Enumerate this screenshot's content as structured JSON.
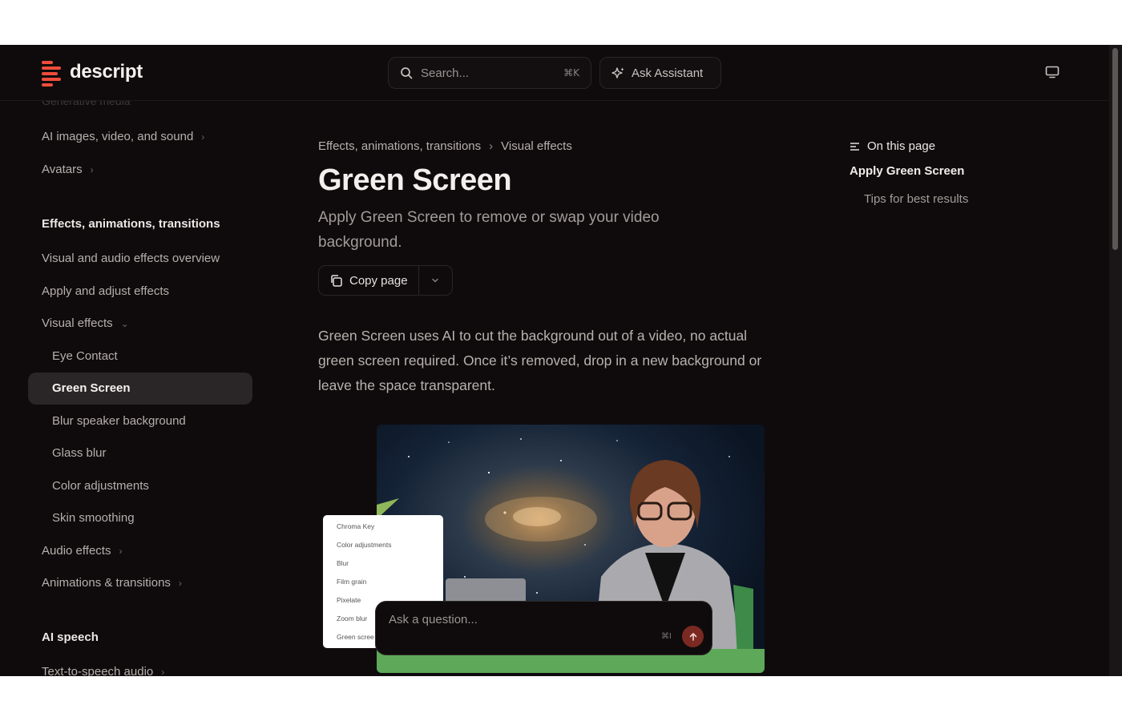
{
  "brand": {
    "name": "descript",
    "accent": "#ef4d3b"
  },
  "header": {
    "search_placeholder": "Search...",
    "search_shortcut": "⌘K",
    "assistant_label": "Ask Assistant"
  },
  "sidebar": {
    "faded_top": "Generative media",
    "items": [
      {
        "label": "AI images, video, and sound",
        "chevron": "›"
      },
      {
        "label": "Avatars",
        "chevron": "›"
      },
      {
        "label": "Effects, animations, transitions"
      },
      {
        "label": "Visual and audio effects overview"
      },
      {
        "label": "Apply and adjust effects"
      },
      {
        "label": "Visual effects",
        "chevron": "⌄"
      },
      {
        "label": "Eye Contact"
      },
      {
        "label": "Green Screen"
      },
      {
        "label": "Blur speaker background"
      },
      {
        "label": "Glass blur"
      },
      {
        "label": "Color adjustments"
      },
      {
        "label": "Skin smoothing"
      },
      {
        "label": "Audio effects",
        "chevron": "›"
      },
      {
        "label": "Animations & transitions",
        "chevron": "›"
      },
      {
        "label": "AI speech"
      },
      {
        "label": "Text-to-speech audio",
        "chevron": "›"
      }
    ]
  },
  "main": {
    "breadcrumb": [
      "Effects, animations, transitions",
      "Visual effects"
    ],
    "breadcrumb_sep": "›",
    "title": "Green Screen",
    "subtitle": "Apply Green Screen to remove or swap your video background.",
    "copy_label": "Copy page",
    "body": "Green Screen uses AI to cut the background out of a video, no actual green screen required. Once it’s removed, drop in a new background or leave the space transparent.",
    "effects_menu": [
      "Chroma Key",
      "Color adjustments",
      "Blur",
      "Film grain",
      "Pixelate",
      "Zoom blur",
      "Green scree"
    ],
    "ask_placeholder": "Ask a question...",
    "ask_shortcut": "⌘I"
  },
  "toc": {
    "heading": "On this page",
    "items": [
      "Apply Green Screen",
      "Tips for best results"
    ]
  }
}
